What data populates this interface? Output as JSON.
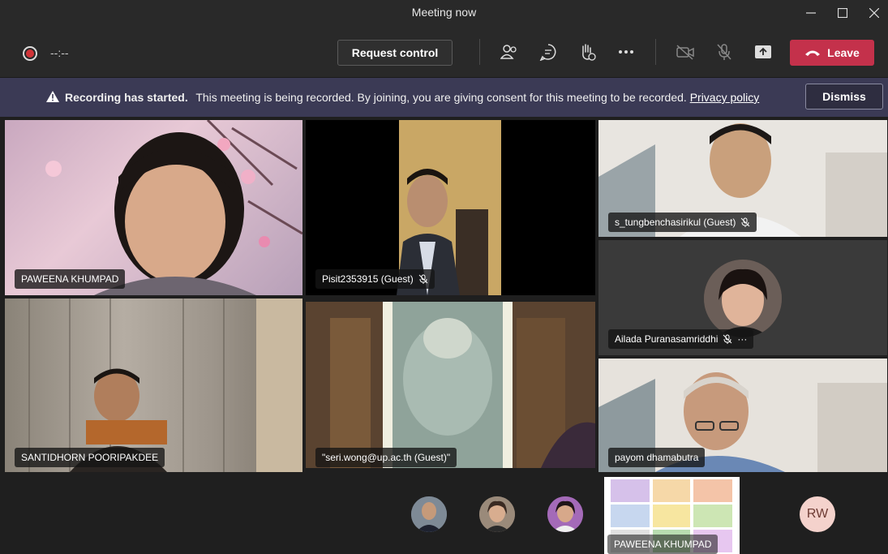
{
  "window": {
    "title": "Meeting now",
    "minimize": "—",
    "maximize": "☐",
    "close": "✕"
  },
  "toolbar": {
    "timer": "--:--",
    "request_control": "Request control",
    "leave": "Leave",
    "icons": [
      "recording-icon",
      "participants-icon",
      "chat-icon",
      "raise-hand-icon",
      "more-icon",
      "camera-off-icon",
      "mic-off-icon",
      "share-icon",
      "hangup-icon"
    ]
  },
  "banner": {
    "bold": "Recording has started.",
    "message": "This meeting is being recorded. By joining, you are giving consent for this meeting to be recorded.",
    "link": "Privacy policy",
    "dismiss": "Dismiss"
  },
  "participants": [
    {
      "name": "PAWEENA KHUMPAD",
      "muted": false
    },
    {
      "name": "Pisit2353915 (Guest)",
      "muted": true
    },
    {
      "name": "s_tungbenchasirikul (Guest)",
      "muted": true
    },
    {
      "name": "Ailada Puranasamriddhi",
      "muted": true,
      "more": "···"
    },
    {
      "name": "SANTIDHORN POORIPAKDEE",
      "muted": false
    },
    {
      "name": "\"seri.wong@up.ac.th (Guest)\"",
      "muted": false
    },
    {
      "name": "payom dhamabutra",
      "muted": false
    },
    {
      "name": "PAWEENA KHUMPAD",
      "muted": false
    }
  ],
  "overflow_avatar": "RW",
  "colors": {
    "leave": "#c4314b",
    "banner": "#3b3a55",
    "record": "#d13438"
  }
}
